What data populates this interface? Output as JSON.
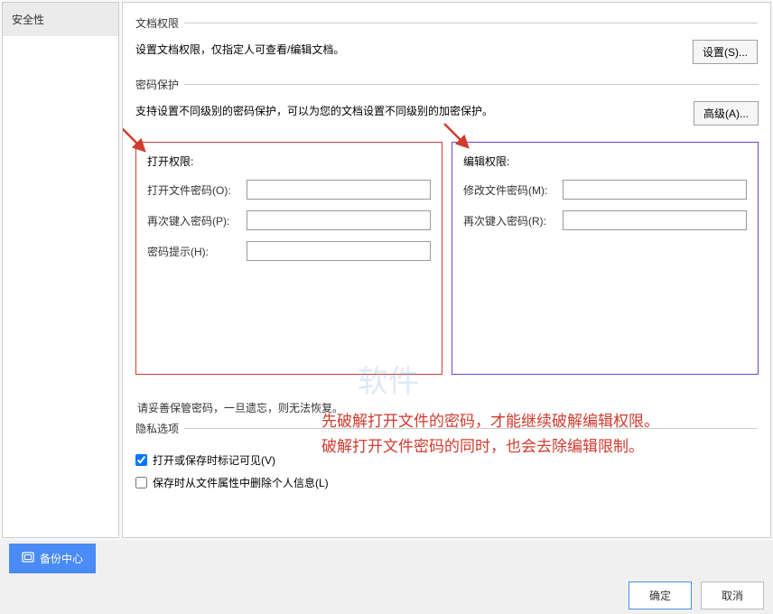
{
  "sidebar": {
    "tab_security": "安全性"
  },
  "docperm": {
    "legend": "文档权限",
    "desc": "设置文档权限，仅指定人可查看/编辑文档。",
    "btn": "设置(S)..."
  },
  "pwd": {
    "legend": "密码保护",
    "desc": "支持设置不同级别的密码保护，可以为您的文档设置不同级别的加密保护。",
    "btn": "高级(A)..."
  },
  "open_perm": {
    "title": "打开权限:",
    "open_pw_label": "打开文件密码(O):",
    "reenter_label": "再次键入密码(P):",
    "hint_label": "密码提示(H):"
  },
  "edit_perm": {
    "title": "编辑权限:",
    "mod_pw_label": "修改文件密码(M):",
    "reenter_label": "再次键入密码(R):"
  },
  "warning": "请妥善保管密码，一旦遗忘，则无法恢复。",
  "privacy": {
    "legend": "隐私选项",
    "chk_mark": "打开或保存时标记可见(V)",
    "chk_remove": "保存时从文件属性中删除个人信息(L)"
  },
  "watermark": "软件",
  "annotation": {
    "line1": "先破解打开文件的密码，才能继续破解编辑权限。",
    "line2": "破解打开文件密码的同时，也会去除编辑限制。"
  },
  "footer": {
    "backup": "备份中心",
    "ok": "确定",
    "cancel": "取消"
  }
}
